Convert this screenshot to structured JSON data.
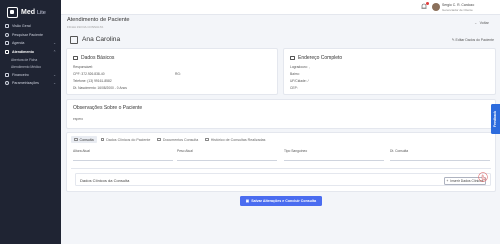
{
  "brand": {
    "name": "Med",
    "suffix": "Lite"
  },
  "sidebar": {
    "items": [
      {
        "label": "Visão Geral",
        "icon": "grid-icon"
      },
      {
        "label": "Pesquisar Paciente",
        "icon": "search-icon"
      },
      {
        "label": "Agenda",
        "icon": "calendar-icon",
        "chevron": "⌄"
      },
      {
        "label": "Atendimento",
        "icon": "stethoscope-icon",
        "chevron": "⌃",
        "active": true
      },
      {
        "label": "Financeiro",
        "icon": "wallet-icon",
        "chevron": "⌄"
      },
      {
        "label": "Parametrizações",
        "icon": "settings-icon",
        "chevron": "⌄"
      }
    ],
    "subitems": [
      "Abertura de Ficha",
      "Atendimento Médico"
    ]
  },
  "topbar": {
    "user_name": "Sergio C. R. Cardozo",
    "user_role": "Gerenciador de Cliente"
  },
  "page": {
    "title": "Atendimento de Paciente",
    "subtitle": "FICHA 193 DA CONSULTA",
    "back_label": "Voltar"
  },
  "patient": {
    "name": "Ana Carolina",
    "edit_label": "Editar Dados do Paciente"
  },
  "dados_basicos": {
    "title": "Dados Básicos",
    "responsavel": "Responsável:",
    "cpf": "CPF: 372.926.838-40",
    "rg": "RG:",
    "telefone": "Telefone: (13) 99161-8582",
    "nascimento": "Dt. Nascimento: 16/08/2000 - 0 Anos"
  },
  "endereco": {
    "title": "Endereço Completo",
    "logradouro": "Logradouro: ,",
    "bairro": "Bairro:",
    "uf_cidade": "UF/Cidade: /",
    "cep": "CEP:"
  },
  "observacoes": {
    "title": "Observações Sobre o Paciente",
    "text": "espero"
  },
  "tabs": [
    {
      "label": "Consulta",
      "active": true
    },
    {
      "label": "Dados Clínicos do Paciente"
    },
    {
      "label": "Documentos Consulta"
    },
    {
      "label": "Histórico de Consultas Realizadas"
    }
  ],
  "consulta": {
    "columns": [
      "Altura Atual",
      "Peso Atual",
      "Tipo Sanguíneo",
      "Dt. Consulta"
    ],
    "clinicos_title": "Dados Clínicos da Consulta",
    "add_label": "Inserir Dados Clínicos"
  },
  "save_label": "Salvar Alterações e Concluir Consulta",
  "feedback_label": "Feedback",
  "colors": {
    "sidebar": "#1f2433",
    "accent": "#4a6cf0",
    "feedback": "#2c6bdd"
  }
}
